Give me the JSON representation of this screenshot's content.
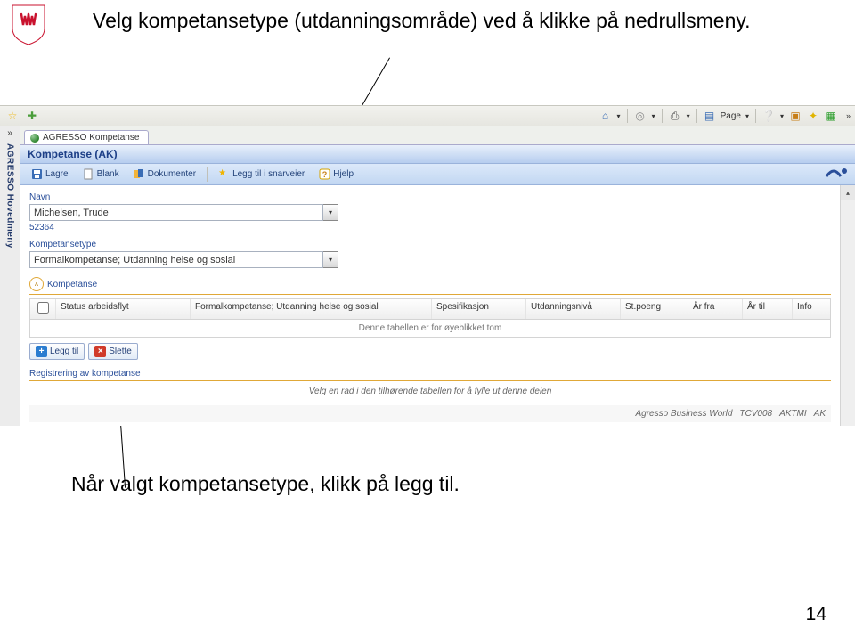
{
  "instruction_top": "Velg kompetansetype (utdanningsområde) ved å klikke på nedrullsmeny.",
  "instruction_bottom": "Når valgt kompetansetype, klikk på legg til.",
  "page_number": "14",
  "ietoolbar": {
    "page_label": "Page"
  },
  "sidebar": {
    "label": "AGRESSO Hovedmeny"
  },
  "tab": {
    "title": "AGRESSO Kompetanse"
  },
  "header": {
    "title": "Kompetanse (AK)"
  },
  "inner_toolbar": {
    "lagre": "Lagre",
    "blank": "Blank",
    "dokumenter": "Dokumenter",
    "snarveier": "Legg til i snarveier",
    "hjelp": "Hjelp"
  },
  "form": {
    "navn_label": "Navn",
    "navn_value": "Michelsen, Trude",
    "navn_id": "52364",
    "komp_label": "Kompetansetype",
    "komp_value": "Formalkompetanse; Utdanning helse og sosial"
  },
  "section": {
    "title": "Kompetanse",
    "columns": [
      "Status arbeidsflyt",
      "Formalkompetanse; Utdanning helse og sosial",
      "Spesifikasjon",
      "Utdanningsnivå",
      "St.poeng",
      "År fra",
      "År til",
      "Info"
    ],
    "empty_text": "Denne tabellen er for øyeblikket tom"
  },
  "actions": {
    "add": "Legg til",
    "delete": "Slette"
  },
  "subsection": {
    "title": "Registrering av kompetanse",
    "body": "Velg en rad i den tilhørende tabellen for å fylle ut denne delen"
  },
  "footer": {
    "product": "Agresso Business World",
    "codes": [
      "TCV008",
      "AKTMI",
      "AK"
    ]
  }
}
